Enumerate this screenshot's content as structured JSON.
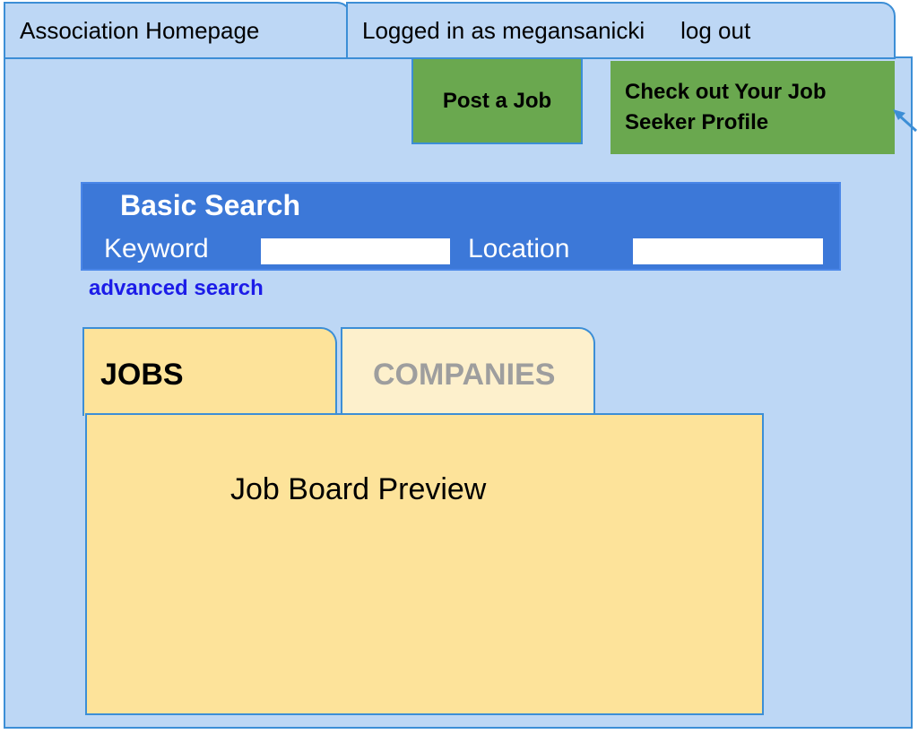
{
  "header": {
    "home_tab": "Association Homepage",
    "logged_in_text": "Logged in as megansanicki",
    "logout_label": "log out"
  },
  "actions": {
    "post_job_label": "Post a Job",
    "profile_label": "Check out Your Job Seeker Profile"
  },
  "search": {
    "title": "Basic Search",
    "keyword_label": "Keyword",
    "keyword_value": "",
    "location_label": "Location",
    "location_value": "",
    "advanced_link": "advanced search"
  },
  "content_tabs": [
    {
      "label": "JOBS",
      "active": true
    },
    {
      "label": "COMPANIES",
      "active": false
    }
  ],
  "preview": {
    "text": "Job Board Preview"
  },
  "icons": {
    "arrow": "arrow-pointer-icon"
  },
  "colors": {
    "frame_bg": "#bdd7f5",
    "frame_border": "#3c8ed6",
    "button_green": "#6aa84f",
    "search_blue": "#3c78d8",
    "link_blue": "#1c1ce8",
    "tab_active": "#fde39a",
    "tab_inactive": "#fdf0cc"
  }
}
